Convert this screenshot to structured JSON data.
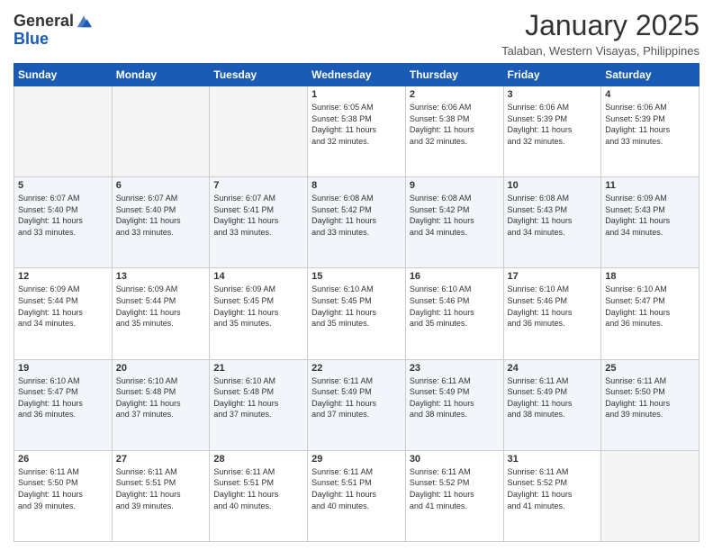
{
  "header": {
    "logo_line1": "General",
    "logo_line2": "Blue",
    "month": "January 2025",
    "location": "Talaban, Western Visayas, Philippines"
  },
  "days_of_week": [
    "Sunday",
    "Monday",
    "Tuesday",
    "Wednesday",
    "Thursday",
    "Friday",
    "Saturday"
  ],
  "weeks": [
    [
      {
        "day": "",
        "info": ""
      },
      {
        "day": "",
        "info": ""
      },
      {
        "day": "",
        "info": ""
      },
      {
        "day": "1",
        "info": "Sunrise: 6:05 AM\nSunset: 5:38 PM\nDaylight: 11 hours\nand 32 minutes."
      },
      {
        "day": "2",
        "info": "Sunrise: 6:06 AM\nSunset: 5:38 PM\nDaylight: 11 hours\nand 32 minutes."
      },
      {
        "day": "3",
        "info": "Sunrise: 6:06 AM\nSunset: 5:39 PM\nDaylight: 11 hours\nand 32 minutes."
      },
      {
        "day": "4",
        "info": "Sunrise: 6:06 AM\nSunset: 5:39 PM\nDaylight: 11 hours\nand 33 minutes."
      }
    ],
    [
      {
        "day": "5",
        "info": "Sunrise: 6:07 AM\nSunset: 5:40 PM\nDaylight: 11 hours\nand 33 minutes."
      },
      {
        "day": "6",
        "info": "Sunrise: 6:07 AM\nSunset: 5:40 PM\nDaylight: 11 hours\nand 33 minutes."
      },
      {
        "day": "7",
        "info": "Sunrise: 6:07 AM\nSunset: 5:41 PM\nDaylight: 11 hours\nand 33 minutes."
      },
      {
        "day": "8",
        "info": "Sunrise: 6:08 AM\nSunset: 5:42 PM\nDaylight: 11 hours\nand 33 minutes."
      },
      {
        "day": "9",
        "info": "Sunrise: 6:08 AM\nSunset: 5:42 PM\nDaylight: 11 hours\nand 34 minutes."
      },
      {
        "day": "10",
        "info": "Sunrise: 6:08 AM\nSunset: 5:43 PM\nDaylight: 11 hours\nand 34 minutes."
      },
      {
        "day": "11",
        "info": "Sunrise: 6:09 AM\nSunset: 5:43 PM\nDaylight: 11 hours\nand 34 minutes."
      }
    ],
    [
      {
        "day": "12",
        "info": "Sunrise: 6:09 AM\nSunset: 5:44 PM\nDaylight: 11 hours\nand 34 minutes."
      },
      {
        "day": "13",
        "info": "Sunrise: 6:09 AM\nSunset: 5:44 PM\nDaylight: 11 hours\nand 35 minutes."
      },
      {
        "day": "14",
        "info": "Sunrise: 6:09 AM\nSunset: 5:45 PM\nDaylight: 11 hours\nand 35 minutes."
      },
      {
        "day": "15",
        "info": "Sunrise: 6:10 AM\nSunset: 5:45 PM\nDaylight: 11 hours\nand 35 minutes."
      },
      {
        "day": "16",
        "info": "Sunrise: 6:10 AM\nSunset: 5:46 PM\nDaylight: 11 hours\nand 35 minutes."
      },
      {
        "day": "17",
        "info": "Sunrise: 6:10 AM\nSunset: 5:46 PM\nDaylight: 11 hours\nand 36 minutes."
      },
      {
        "day": "18",
        "info": "Sunrise: 6:10 AM\nSunset: 5:47 PM\nDaylight: 11 hours\nand 36 minutes."
      }
    ],
    [
      {
        "day": "19",
        "info": "Sunrise: 6:10 AM\nSunset: 5:47 PM\nDaylight: 11 hours\nand 36 minutes."
      },
      {
        "day": "20",
        "info": "Sunrise: 6:10 AM\nSunset: 5:48 PM\nDaylight: 11 hours\nand 37 minutes."
      },
      {
        "day": "21",
        "info": "Sunrise: 6:10 AM\nSunset: 5:48 PM\nDaylight: 11 hours\nand 37 minutes."
      },
      {
        "day": "22",
        "info": "Sunrise: 6:11 AM\nSunset: 5:49 PM\nDaylight: 11 hours\nand 37 minutes."
      },
      {
        "day": "23",
        "info": "Sunrise: 6:11 AM\nSunset: 5:49 PM\nDaylight: 11 hours\nand 38 minutes."
      },
      {
        "day": "24",
        "info": "Sunrise: 6:11 AM\nSunset: 5:49 PM\nDaylight: 11 hours\nand 38 minutes."
      },
      {
        "day": "25",
        "info": "Sunrise: 6:11 AM\nSunset: 5:50 PM\nDaylight: 11 hours\nand 39 minutes."
      }
    ],
    [
      {
        "day": "26",
        "info": "Sunrise: 6:11 AM\nSunset: 5:50 PM\nDaylight: 11 hours\nand 39 minutes."
      },
      {
        "day": "27",
        "info": "Sunrise: 6:11 AM\nSunset: 5:51 PM\nDaylight: 11 hours\nand 39 minutes."
      },
      {
        "day": "28",
        "info": "Sunrise: 6:11 AM\nSunset: 5:51 PM\nDaylight: 11 hours\nand 40 minutes."
      },
      {
        "day": "29",
        "info": "Sunrise: 6:11 AM\nSunset: 5:51 PM\nDaylight: 11 hours\nand 40 minutes."
      },
      {
        "day": "30",
        "info": "Sunrise: 6:11 AM\nSunset: 5:52 PM\nDaylight: 11 hours\nand 41 minutes."
      },
      {
        "day": "31",
        "info": "Sunrise: 6:11 AM\nSunset: 5:52 PM\nDaylight: 11 hours\nand 41 minutes."
      },
      {
        "day": "",
        "info": ""
      }
    ]
  ]
}
